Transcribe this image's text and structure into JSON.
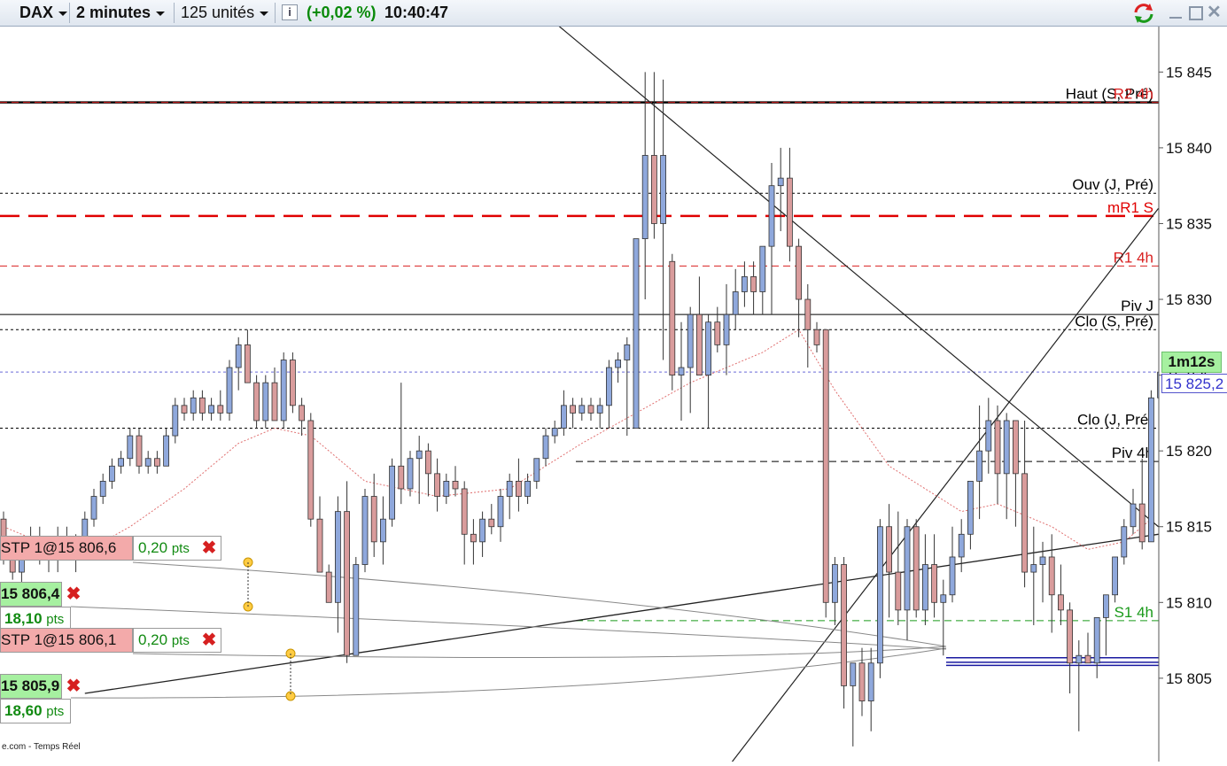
{
  "toolbar": {
    "instrument": "DAX",
    "timeframe": "2 minutes",
    "units": "125 unités",
    "change": "(+0,02 %)",
    "time": "10:40:47"
  },
  "chart_data": {
    "type": "candlestick",
    "y_axis": {
      "ticks": [
        "15 845",
        "15 840",
        "15 835",
        "15 830",
        "15 825",
        "15 820",
        "15 815",
        "15 810",
        "15 805"
      ],
      "range": [
        15799.5,
        15848
      ]
    },
    "timer_label": "1m12s",
    "last_price_label": "15 825,2",
    "last_price": 15825.2,
    "levels": [
      {
        "label": "Haut (S, Pré)",
        "value": 15843,
        "color": "#000000",
        "style": "solid"
      },
      {
        "label": "R2 4h",
        "value": 15843,
        "color": "#d92020",
        "style": "dashed"
      },
      {
        "label": "Ouv (J, Pré)",
        "value": 15837,
        "color": "#000000",
        "style": "dotted"
      },
      {
        "label": "mR1 S",
        "value": 15835.5,
        "color": "#e00000",
        "style": "dashed"
      },
      {
        "label": "R1 4h",
        "value": 15832.2,
        "color": "#d92020",
        "style": "dashed"
      },
      {
        "label": "Piv J",
        "value": 15829,
        "color": "#000000",
        "style": "solid"
      },
      {
        "label": "Clo (S, Pré)",
        "value": 15828,
        "color": "#000000",
        "style": "dotted"
      },
      {
        "label": "Clo (J, Pré)",
        "value": 15821.5,
        "color": "#000000",
        "style": "dotted"
      },
      {
        "label": "Piv 4h",
        "value": 15819.3,
        "color": "#000000",
        "style": "dashed"
      },
      {
        "label": "S1 4h",
        "value": 15808.8,
        "color": "#1a9a1a",
        "style": "dashed"
      }
    ],
    "candles": [
      [
        15815.5,
        15816,
        15812.5,
        15813
      ],
      [
        15813,
        15813.5,
        15811.5,
        15812
      ],
      [
        15812,
        15814,
        15811,
        15813.5
      ],
      [
        15813.5,
        15815,
        15813,
        15814
      ],
      [
        15814,
        15815,
        15812.5,
        15813
      ],
      [
        15813,
        15814,
        15812,
        15813.5
      ],
      [
        15813.5,
        15815,
        15812,
        15814
      ],
      [
        15814,
        15815,
        15813,
        15813.5
      ],
      [
        15813.5,
        15814.5,
        15812,
        15814
      ],
      [
        15814,
        15816,
        15813,
        15815.5
      ],
      [
        15815.5,
        15817.5,
        15815,
        15817
      ],
      [
        15817,
        15818.5,
        15816.5,
        15818
      ],
      [
        15818,
        15819.5,
        15817.5,
        15819
      ],
      [
        15819,
        15820,
        15818.5,
        15819.5
      ],
      [
        15819.5,
        15821.5,
        15819,
        15821
      ],
      [
        15821,
        15821.5,
        15818.5,
        15819
      ],
      [
        15819,
        15820,
        15818.5,
        15819.5
      ],
      [
        15819.5,
        15820,
        15818.5,
        15819
      ],
      [
        15819,
        15821.5,
        15819,
        15821
      ],
      [
        15821,
        15823.5,
        15820.5,
        15823
      ],
      [
        15823,
        15823.5,
        15822,
        15822.5
      ],
      [
        15822.5,
        15824,
        15822,
        15823.5
      ],
      [
        15823.5,
        15824,
        15822,
        15822.5
      ],
      [
        15822.5,
        15823.5,
        15822,
        15823
      ],
      [
        15823,
        15824,
        15822,
        15822.5
      ],
      [
        15822.5,
        15826,
        15822,
        15825.5
      ],
      [
        15825.5,
        15827.5,
        15824,
        15827
      ],
      [
        15827,
        15828,
        15824.5,
        15824.5
      ],
      [
        15824.5,
        15825,
        15821.5,
        15822
      ],
      [
        15822,
        15825,
        15821.5,
        15824.5
      ],
      [
        15824.5,
        15825.5,
        15822,
        15822
      ],
      [
        15822,
        15826.5,
        15821.5,
        15826
      ],
      [
        15826,
        15826.5,
        15822.5,
        15823
      ],
      [
        15823,
        15823.5,
        15821,
        15822
      ],
      [
        15822,
        15822.5,
        15815,
        15815.5
      ],
      [
        15815.5,
        15817,
        15812,
        15812
      ],
      [
        15812,
        15812.5,
        15810,
        15810
      ],
      [
        15810,
        15817,
        15808,
        15816
      ],
      [
        15816,
        15818,
        15806,
        15806.5
      ],
      [
        15806.5,
        15813,
        15806.5,
        15812.5
      ],
      [
        15812.5,
        15817.5,
        15812,
        15817
      ],
      [
        15817,
        15818.5,
        15813,
        15814
      ],
      [
        15814,
        15817,
        15812.5,
        15815.5
      ],
      [
        15815.5,
        15819.5,
        15815,
        15819
      ],
      [
        15819,
        15824.5,
        15816.5,
        15817.5
      ],
      [
        15817.5,
        15820,
        15817,
        15819.5
      ],
      [
        15819.5,
        15821,
        15816.5,
        15820
      ],
      [
        15820,
        15820.5,
        15817,
        15818.5
      ],
      [
        15818.5,
        15819.5,
        15816,
        15817
      ],
      [
        15817,
        15818.5,
        15816.5,
        15818
      ],
      [
        15818,
        15819,
        15817,
        15817.5
      ],
      [
        15817.5,
        15818,
        15812.5,
        15814.5
      ],
      [
        15814.5,
        15815.5,
        15812.5,
        15814
      ],
      [
        15814,
        15816,
        15813,
        15815.5
      ],
      [
        15815.5,
        15816.5,
        15814.5,
        15815
      ],
      [
        15815,
        15817.5,
        15814,
        15817
      ],
      [
        15817,
        15818.5,
        15815.5,
        15818
      ],
      [
        15818,
        15819.5,
        15816,
        15817
      ],
      [
        15817,
        15818.5,
        15816.5,
        15818
      ],
      [
        15818,
        15819.5,
        15817.5,
        15819.5
      ],
      [
        15819.5,
        15821.5,
        15819,
        15821
      ],
      [
        15821,
        15822,
        15820.5,
        15821.5
      ],
      [
        15821.5,
        15824,
        15821,
        15823
      ],
      [
        15823,
        15823.5,
        15821.5,
        15822.5
      ],
      [
        15822.5,
        15823.5,
        15822,
        15823
      ],
      [
        15823,
        15823.5,
        15822,
        15822.5
      ],
      [
        15822.5,
        15823.5,
        15821.5,
        15823
      ],
      [
        15823,
        15826,
        15821.5,
        15825.5
      ],
      [
        15825.5,
        15826.5,
        15824.5,
        15826
      ],
      [
        15826,
        15827.5,
        15821,
        15827
      ],
      [
        15821.5,
        15830,
        15821.5,
        15834
      ],
      [
        15834,
        15845,
        15830,
        15839.5
      ],
      [
        15839.5,
        15845,
        15834,
        15835
      ],
      [
        15835,
        15844.5,
        15826,
        15839.5
      ],
      [
        15832.5,
        15833,
        15824,
        15825
      ],
      [
        15825,
        15828.5,
        15822,
        15825.5
      ],
      [
        15825.5,
        15829.5,
        15822.5,
        15829
      ],
      [
        15829,
        15831.5,
        15826,
        15825
      ],
      [
        15825,
        15829,
        15821.5,
        15828.5
      ],
      [
        15828.5,
        15829.5,
        15826.5,
        15827
      ],
      [
        15827,
        15831,
        15825,
        15829
      ],
      [
        15829,
        15832,
        15828,
        15830.5
      ],
      [
        15830.5,
        15832.5,
        15829.5,
        15831.5
      ],
      [
        15831.5,
        15832.5,
        15829,
        15830.5
      ],
      [
        15830.5,
        15833,
        15829,
        15833.5
      ],
      [
        15833.5,
        15839,
        15829,
        15837.5
      ],
      [
        15837.5,
        15840,
        15834.5,
        15838
      ],
      [
        15838,
        15840,
        15832.5,
        15833.5
      ],
      [
        15833.5,
        15834,
        15827.5,
        15830
      ],
      [
        15830,
        15831,
        15825.5,
        15828
      ],
      [
        15828,
        15828.5,
        15826.5,
        15827
      ],
      [
        15828,
        15828,
        15809,
        15810
      ],
      [
        15810,
        15813,
        15808.5,
        15812.5
      ],
      [
        15812.5,
        15813,
        15803,
        15804.5
      ],
      [
        15804.5,
        15806,
        15800.5,
        15806
      ],
      [
        15806,
        15807,
        15802.5,
        15803.5
      ],
      [
        15803.5,
        15807,
        15801.5,
        15806
      ],
      [
        15806,
        15815.5,
        15805,
        15815
      ],
      [
        15815,
        15816.5,
        15809,
        15812
      ],
      [
        15812,
        15816,
        15808.5,
        15809.5
      ],
      [
        15809.5,
        15815.5,
        15807.5,
        15815
      ],
      [
        15815,
        15815.5,
        15809,
        15809.5
      ],
      [
        15809.5,
        15814.5,
        15808.5,
        15812.5
      ],
      [
        15812.5,
        15814.5,
        15809,
        15810
      ],
      [
        15810,
        15811.5,
        15806.5,
        15810.5
      ],
      [
        15810.5,
        15815,
        15810,
        15813
      ],
      [
        15813,
        15815.5,
        15812,
        15814.5
      ],
      [
        15814.5,
        15818,
        15813.5,
        15818
      ],
      [
        15818,
        15823,
        15815.5,
        15820
      ],
      [
        15820,
        15823.5,
        15818.5,
        15822
      ],
      [
        15822,
        15823,
        15816.5,
        15818.5
      ],
      [
        15818.5,
        15822.5,
        15815.5,
        15822
      ],
      [
        15822,
        15822,
        15815,
        15818.5
      ],
      [
        15818.5,
        15822,
        15811,
        15812
      ],
      [
        15812,
        15815,
        15808.5,
        15812.5
      ],
      [
        15812.5,
        15814,
        15810,
        15813
      ],
      [
        15813,
        15814.5,
        15808,
        15810.5
      ],
      [
        15810.5,
        15812.5,
        15808.5,
        15809.5
      ],
      [
        15809.5,
        15810,
        15804,
        15806
      ],
      [
        15806,
        15807.5,
        15801.5,
        15806.5
      ],
      [
        15806.5,
        15808,
        15806,
        15806
      ],
      [
        15806,
        15809,
        15805,
        15809
      ],
      [
        15809,
        15810.5,
        15806.5,
        15810.5
      ],
      [
        15810.5,
        15813,
        15810,
        15813
      ],
      [
        15813,
        15815.5,
        15812.5,
        15815
      ],
      [
        15815,
        15817.5,
        15814.5,
        15816.5
      ],
      [
        15816.5,
        15819.5,
        15813.5,
        15814
      ],
      [
        15814,
        15824,
        15814,
        15823.5
      ],
      [
        15823.5,
        15826,
        15823,
        15825.2
      ]
    ],
    "moving_average": [
      [
        0,
        15815
      ],
      [
        8,
        15813
      ],
      [
        14,
        15815
      ],
      [
        20,
        15817.5
      ],
      [
        26,
        15820.5
      ],
      [
        30,
        15821.5
      ],
      [
        34,
        15821
      ],
      [
        40,
        15818
      ],
      [
        48,
        15817
      ],
      [
        56,
        15817.5
      ],
      [
        64,
        15820.5
      ],
      [
        70,
        15822.5
      ],
      [
        76,
        15824.5
      ],
      [
        84,
        15826.5
      ],
      [
        88,
        15828
      ],
      [
        92,
        15824
      ],
      [
        98,
        15819
      ],
      [
        106,
        15816
      ],
      [
        110,
        15816.5
      ],
      [
        116,
        15815
      ],
      [
        120,
        15813.5
      ],
      [
        124,
        15814
      ],
      [
        127,
        15815.5
      ]
    ],
    "orders": [
      {
        "stop": "STP 1@15 806,6",
        "pts": "0,20",
        "unit": "pts"
      },
      {
        "price": "15 806,4",
        "pts": "18,10",
        "unit": "pts"
      },
      {
        "stop": "STP 1@15 806,1",
        "pts": "0,20",
        "unit": "pts"
      },
      {
        "price": "15 805,9",
        "pts": "18,60",
        "unit": "pts"
      }
    ],
    "source_label": "e.com - Temps Réel"
  },
  "colors": {
    "bull": "#8fa8dc",
    "bear": "#d99c9c",
    "wick": "#333333",
    "accent_green": "#0a8a0a",
    "order_red": "#f3aaaa",
    "order_green": "#a6f0a0",
    "ma": "#e07070"
  }
}
